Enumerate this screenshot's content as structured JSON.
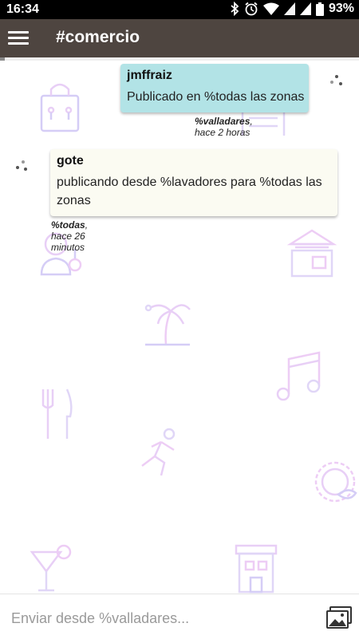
{
  "status_bar": {
    "time": "16:34",
    "battery": "93%",
    "icons": [
      "bluetooth-icon",
      "alarm-icon",
      "wifi-icon",
      "signal-icon",
      "signal-icon",
      "battery-icon"
    ]
  },
  "app_bar": {
    "title": "#comercio",
    "menu_icon": "hamburger-menu-icon",
    "color": "#4e4540"
  },
  "messages": [
    {
      "author": "jmffraiz",
      "text": "Publicado en %todas las zonas",
      "zone": "%valladares",
      "time_ago": ", hace 2 horas",
      "bubble_color": "#b2e3e6",
      "side": "right"
    },
    {
      "author": "gote",
      "text_line1": "publicando desde %lavadores para %todas las",
      "text_line2": "zonas",
      "zone": "%todas",
      "time_ago": ", hace 26 minutos",
      "bubble_color": "#fbfbf2",
      "side": "left"
    }
  ],
  "composer": {
    "placeholder": "Enviar desde %valladares...",
    "value": "",
    "send_icon": "gallery-icon"
  },
  "background_icons": [
    "shopping-bag-icon",
    "building-icon",
    "person-icon",
    "shop-icon",
    "palm-tree-icon",
    "music-note-icon",
    "cutlery-icon",
    "runner-icon",
    "pie-icon",
    "cocktail-icon",
    "storefront-icon"
  ]
}
